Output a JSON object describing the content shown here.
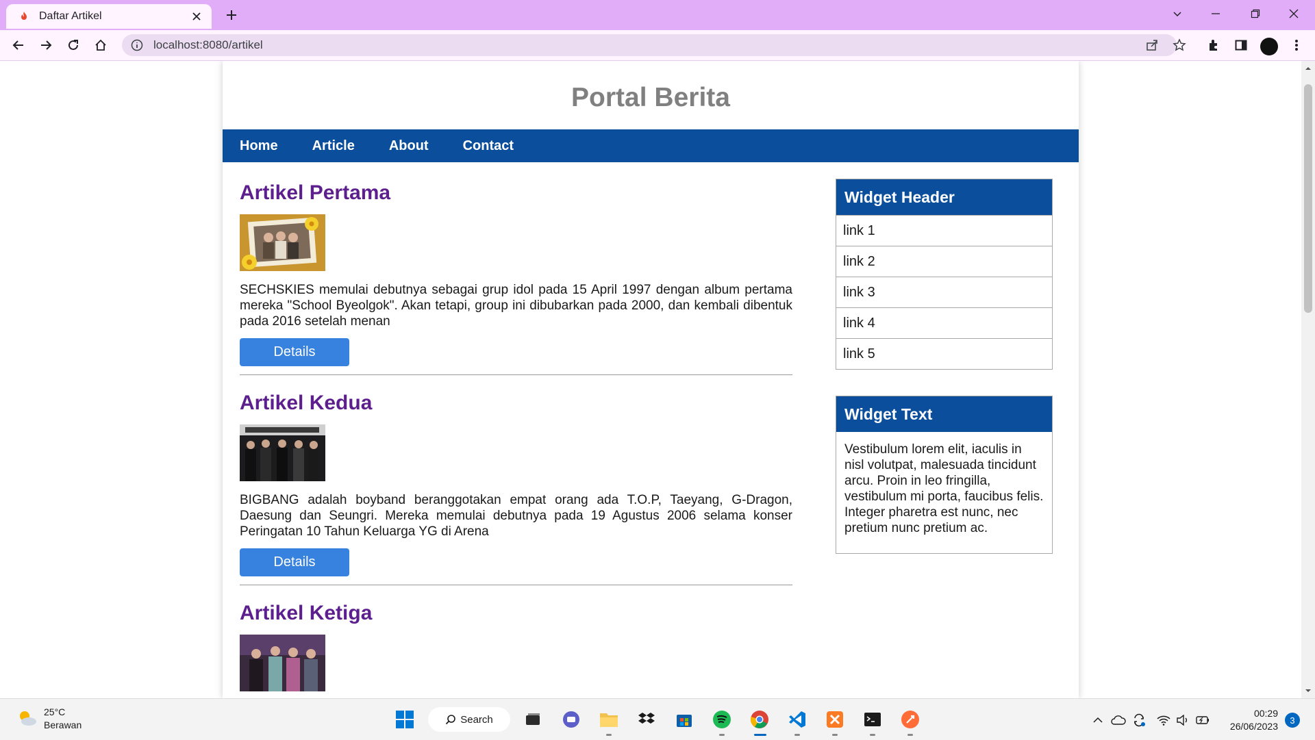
{
  "browser": {
    "tab_title": "Daftar Artikel",
    "url": "localhost:8080/artikel"
  },
  "site": {
    "title": "Portal Berita",
    "nav": [
      "Home",
      "Article",
      "About",
      "Contact"
    ]
  },
  "articles": [
    {
      "title": "Artikel Pertama",
      "body": "SECHSKIES memulai debutnya sebagai grup idol pada 15 April 1997 dengan album pertama mereka \"School Byeolgok\". Akan tetapi, group ini dibubarkan pada 2000, dan kembali dibentuk pada 2016 setelah menan",
      "button": "Details"
    },
    {
      "title": "Artikel Kedua",
      "body": "BIGBANG adalah boyband beranggotakan empat orang ada T.O.P, Taeyang, G-Dragon, Daesung dan Seungri. Mereka memulai debutnya pada 19 Agustus 2006 selama konser Peringatan 10 Tahun Keluarga YG di Arena",
      "button": "Details"
    },
    {
      "title": "Artikel Ketiga"
    }
  ],
  "sidebar": {
    "widget1": {
      "header": "Widget Header",
      "links": [
        "link 1",
        "link 2",
        "link 3",
        "link 4",
        "link 5"
      ]
    },
    "widget2": {
      "header": "Widget Text",
      "text": "Vestibulum lorem elit, iaculis in nisl volutpat, malesuada tincidunt arcu. Proin in leo fringilla, vestibulum mi porta, faucibus felis. Integer pharetra est nunc, nec pretium nunc pretium ac."
    }
  },
  "taskbar": {
    "weather_temp": "25°C",
    "weather_desc": "Berawan",
    "search_label": "Search",
    "time": "00:29",
    "date": "26/06/2023",
    "notification_count": "3"
  },
  "colors": {
    "chrome": "#e2adf8",
    "nav_bar": "#0b4f9c",
    "article_title": "#5c1f8d",
    "button": "#3782de"
  }
}
